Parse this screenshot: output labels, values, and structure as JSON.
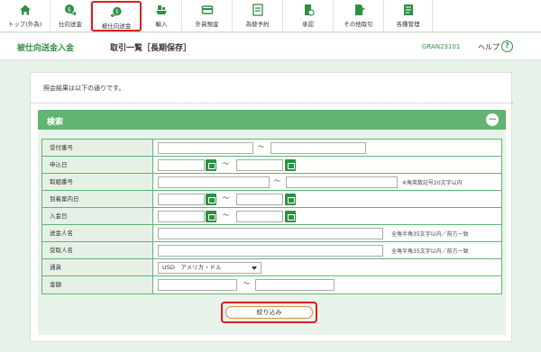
{
  "nav": {
    "items": [
      {
        "label": "トップ(外為)",
        "icon": "home-icon"
      },
      {
        "label": "仕向送金",
        "icon": "yen-send-icon"
      },
      {
        "label": "被仕向送金",
        "icon": "yen-receive-icon"
      },
      {
        "label": "輸入",
        "icon": "ship-icon"
      },
      {
        "label": "外貨預金",
        "icon": "deposit-icon"
      },
      {
        "label": "為替予約",
        "icon": "exchange-contract-icon"
      },
      {
        "label": "承認",
        "icon": "approve-icon"
      },
      {
        "label": "その他取引",
        "icon": "other-transaction-icon"
      },
      {
        "label": "各種管理",
        "icon": "management-icon"
      }
    ],
    "active": "被仕向送金"
  },
  "header": {
    "section": "被仕向送金入金",
    "title": "取引一覧［長期保存］",
    "screen_code": "GRAN23101",
    "help_label": "ヘルプ",
    "help_icon": "?"
  },
  "message": "照会結果は以下の通りです。",
  "search": {
    "title": "検索",
    "collapse_symbol": "−",
    "fields": {
      "receipt_no": {
        "label": "受付番号"
      },
      "apply_date": {
        "label": "申込日"
      },
      "ref_no": {
        "label": "取組番号",
        "note": "※角英数記号20文字以内"
      },
      "arrival_date": {
        "label": "到着案内日"
      },
      "deposit_date": {
        "label": "入金日"
      },
      "remitter": {
        "label": "送金人名",
        "note": "全角半角35文字以内／前方一致"
      },
      "beneficiary": {
        "label": "受取人名",
        "note": "全角半角35文字以内／前方一致"
      },
      "currency": {
        "label": "通貨",
        "value": "USD　アメリカ・ドル"
      },
      "amount": {
        "label": "金額"
      }
    },
    "tilde": "～",
    "submit_label": "絞り込み"
  },
  "colors": {
    "accent": "#62b471",
    "highlight": "#d6221c"
  }
}
